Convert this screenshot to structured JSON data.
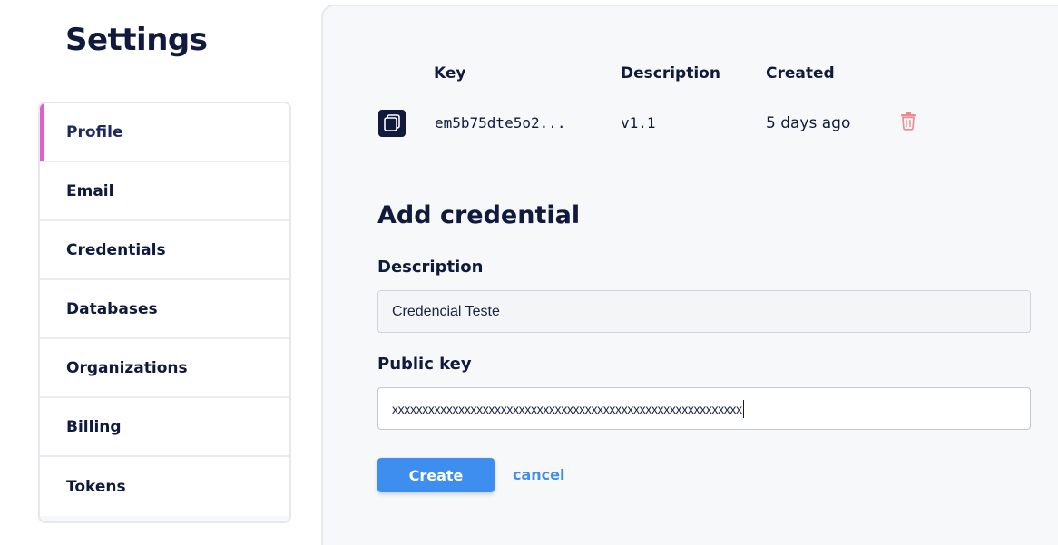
{
  "page": {
    "title": "Settings"
  },
  "sidebar": {
    "items": [
      {
        "label": "Profile",
        "active": true
      },
      {
        "label": "Email"
      },
      {
        "label": "Credentials"
      },
      {
        "label": "Databases"
      },
      {
        "label": "Organizations"
      },
      {
        "label": "Billing"
      },
      {
        "label": "Tokens"
      }
    ]
  },
  "credentials_table": {
    "headers": {
      "key": "Key",
      "description": "Description",
      "created": "Created"
    },
    "rows": [
      {
        "key": "em5b75dte5o2...",
        "description": "v1.1",
        "created": "5 days ago",
        "copy_icon": "copy-icon",
        "delete_icon": "trash-icon"
      }
    ]
  },
  "add_credential": {
    "title": "Add credential",
    "description_label": "Description",
    "description_value": "Credencial Teste",
    "public_key_label": "Public key",
    "public_key_value": "xxxxxxxxxxxxxxxxxxxxxxxxxxxxxxxxxxxxxxxxxxxxxxxxxxxxxxxxxx",
    "create_label": "Create",
    "cancel_label": "cancel"
  },
  "colors": {
    "accent": "#3d8eee",
    "active_marker": "#e55bd0",
    "text_primary": "#0f1a3c",
    "danger": "#f08a8a"
  }
}
